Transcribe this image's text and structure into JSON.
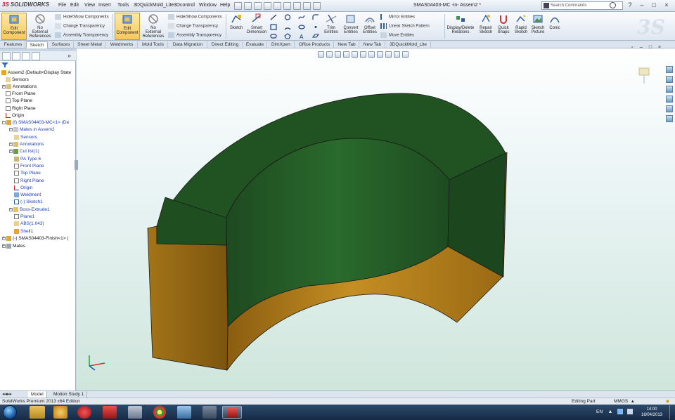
{
  "app": {
    "logo_text": "SOLIDWORKS",
    "window_title": "SMAS04403-MC -in- Assem2 *",
    "menus": [
      "File",
      "Edit",
      "View",
      "Insert",
      "Tools",
      "3DQuickMold_Lite",
      "3Dcontrol",
      "Window",
      "Help"
    ],
    "search_placeholder": "Search Commands"
  },
  "command_manager": {
    "edit_component_left": "Edit\nComponent",
    "no_external_refs_left": "No\nExternal\nReferences",
    "hide_show_components": "Hide/Show Components",
    "change_transparency": "Change Transparency",
    "assembly_transparency": "Assembly Transparency",
    "edit_component_right": "Edit\nComponent",
    "no_external_refs_right": "No\nExternal\nReferences",
    "hide_show_components_2": "Hide/Show Components",
    "change_transparency_2": "Change Transparency",
    "assembly_transparency_2": "Assembly Transparency",
    "sketch": "Sketch",
    "smart_dimension": "Smart\nDimension",
    "trim_entities": "Trim\nEntities",
    "convert_entities": "Convert\nEntities",
    "offset_entities": "Offset\nEntities",
    "mirror_entities": "Mirror Entities",
    "linear_sketch_pattern": "Linear Sketch Pattern",
    "move_entities": "Move Entities",
    "display_delete_relations": "Display/Delete\nRelations",
    "repair_sketch": "Repair\nSketch",
    "quick_snaps": "Quick\nSnaps",
    "rapid_sketch": "Rapid\nSketch",
    "sketch_picture": "Sketch\nPicture",
    "conic": "Conic"
  },
  "tabs": [
    "Features",
    "Sketch",
    "Surfaces",
    "Sheet Metal",
    "Weldments",
    "Mold Tools",
    "Data Migration",
    "Direct Editing",
    "Evaluate",
    "DimXpert",
    "Office Products",
    "New Tab",
    "New Tab",
    "3DQuickMold_Lite"
  ],
  "active_tab": "Sketch",
  "feature_tree": [
    {
      "label": "Assem2  (Default<Display State",
      "blue": false
    },
    {
      "label": "Sensors",
      "blue": false
    },
    {
      "label": "Annotations",
      "blue": false
    },
    {
      "label": "Front Plane",
      "blue": false
    },
    {
      "label": "Top Plane",
      "blue": false
    },
    {
      "label": "Right Plane",
      "blue": false
    },
    {
      "label": "Origin",
      "blue": false
    },
    {
      "label": "(f) SMAS04403-MC<1> (De",
      "blue": true
    },
    {
      "label": "Mates in Assem2",
      "blue": true
    },
    {
      "label": "Sensors",
      "blue": true
    },
    {
      "label": "Annotations",
      "blue": true
    },
    {
      "label": "Cut list(1)",
      "blue": true
    },
    {
      "label": "PA Type 6",
      "blue": true
    },
    {
      "label": "Front Plane",
      "blue": true
    },
    {
      "label": "Top Plane",
      "blue": true
    },
    {
      "label": "Right Plane",
      "blue": true
    },
    {
      "label": "Origin",
      "blue": true
    },
    {
      "label": "Weldment",
      "blue": true
    },
    {
      "label": "(-) Sketch1",
      "blue": true
    },
    {
      "label": "Boss-Extrude1",
      "blue": true
    },
    {
      "label": "Plane1",
      "blue": true
    },
    {
      "label": "ABS(1.043)",
      "blue": true
    },
    {
      "label": "Shell1",
      "blue": true
    },
    {
      "label": "(-) SMAS04403-Finish<1> (",
      "blue": false
    },
    {
      "label": "Mates",
      "blue": false
    }
  ],
  "bottom_tabs": [
    "Model",
    "Motion Study 1"
  ],
  "status": {
    "edition": "SolidWorks Premium 2013 x64 Edition",
    "editing": "Editing Part",
    "units": "MMGS"
  },
  "taskbar": {
    "language": "EN",
    "time": "14:00",
    "date": "16/04/2013"
  },
  "colors": {
    "shell_green": "#1f4f1f",
    "frame_orange": "#b07a17",
    "viewport_top": "#ffffff",
    "viewport_bottom": "#cfe6dc"
  }
}
